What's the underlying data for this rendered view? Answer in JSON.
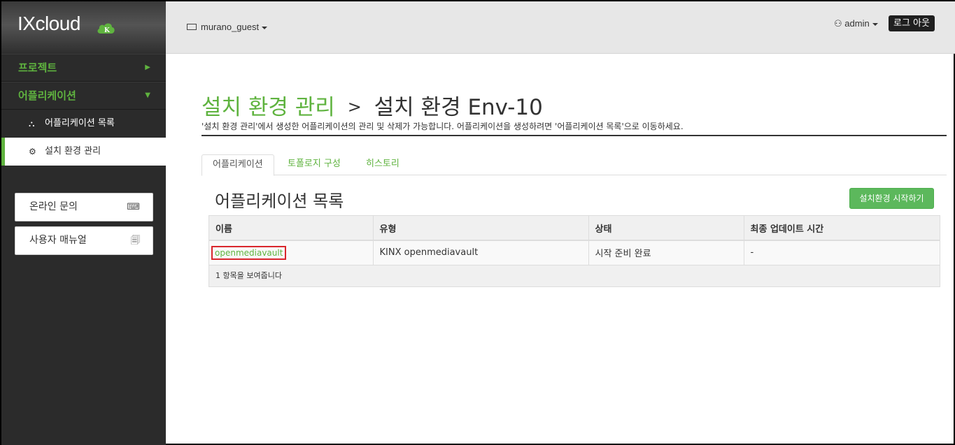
{
  "app": {
    "logo_text": "IXcloud",
    "logo_badge": "K"
  },
  "sidebar": {
    "menus": [
      {
        "label": "프로젝트",
        "arrow": "▶"
      },
      {
        "label": "어플리케이션",
        "arrow": "▼"
      }
    ],
    "sub_items": [
      {
        "label": "어플리케이션 목록",
        "icon": "cubes-icon",
        "glyph": "⛬"
      },
      {
        "label": "설치 환경 관리",
        "icon": "gears-icon",
        "glyph": "⚙"
      }
    ],
    "buttons": [
      {
        "label": "온라인 문의",
        "icon": "keyboard-icon",
        "glyph": "⌨"
      },
      {
        "label": "사용자 매뉴얼",
        "icon": "document-icon",
        "glyph": "🗐"
      }
    ]
  },
  "header": {
    "tenant": "murano_guest",
    "user": "admin",
    "logout": "로그 아웃"
  },
  "page": {
    "breadcrumb_link": "설치 환경 관리",
    "separator": ">",
    "title": "설치 환경 Env-10",
    "description": "'설치 환경 관리'에서 생성한 어플리케이션의 관리 및 삭제가 가능합니다. 어플리케이션을 생성하려면 '어플리케이션 목록'으로 이동하세요."
  },
  "tabs": [
    {
      "label": "어플리케이션",
      "active": true
    },
    {
      "label": "토폴로지 구성",
      "active": false
    },
    {
      "label": "히스토리",
      "active": false
    }
  ],
  "section": {
    "title": "어플리케이션 목록",
    "start_button": "설치환경 시작하기"
  },
  "table": {
    "columns": [
      "이름",
      "유형",
      "상태",
      "최종 업데이트 시간"
    ],
    "rows": [
      [
        "openmediavault",
        "KINX openmediavault",
        "시작 준비 완료",
        "-"
      ]
    ],
    "footer": "1 항목을 보여줍니다"
  },
  "colors": {
    "accent": "#5fb33f",
    "sidebar_bg": "#2b2b2b",
    "highlight_border": "#d9262c",
    "start_button": "#5cb85c"
  }
}
